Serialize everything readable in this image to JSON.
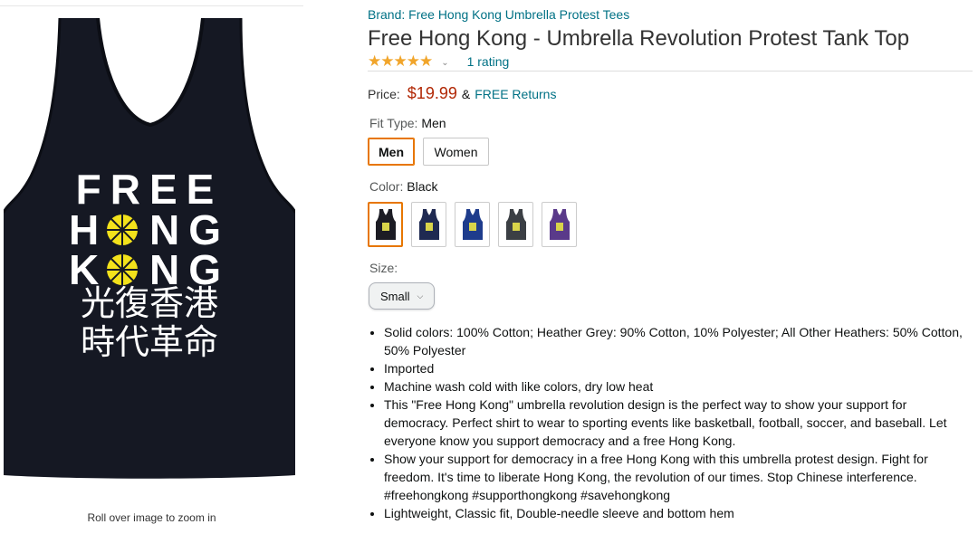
{
  "image": {
    "print_line1": "FREE",
    "print_line2": "HONG",
    "print_line3": "KONG",
    "print_chinese1": "光復香港",
    "print_chinese2": "時代革命",
    "zoom_caption": "Roll over image to zoom in"
  },
  "product": {
    "brand": "Brand: Free Hong Kong Umbrella Protest Tees",
    "title": "Free Hong Kong - Umbrella Revolution Protest Tank Top",
    "stars": "★★★★★",
    "rating_text": "1 rating",
    "price_label": "Price:",
    "price": "$19.99",
    "price_amp": "&",
    "returns": "FREE Returns"
  },
  "fit": {
    "label": "Fit Type:",
    "selected": "Men",
    "options": [
      "Men",
      "Women"
    ]
  },
  "color": {
    "label": "Color:",
    "selected": "Black",
    "swatches": [
      {
        "name": "black",
        "hex": "#1c1c24"
      },
      {
        "name": "navy",
        "hex": "#1f2a52"
      },
      {
        "name": "royal",
        "hex": "#1e3c8c"
      },
      {
        "name": "charcoal",
        "hex": "#3b3f44"
      },
      {
        "name": "purple",
        "hex": "#5a3a8a"
      }
    ]
  },
  "size": {
    "label": "Size:",
    "selected": "Small"
  },
  "bullets": [
    "Solid colors: 100% Cotton; Heather Grey: 90% Cotton, 10% Polyester; All Other Heathers: 50% Cotton, 50% Polyester",
    "Imported",
    "Machine wash cold with like colors, dry low heat",
    "This \"Free Hong Kong\" umbrella revolution design is the perfect way to show your support for democracy. Perfect shirt to wear to sporting events like basketball, football, soccer, and baseball. Let everyone know you support democracy and a free Hong Kong.",
    "Show your support for democracy in a free Hong Kong with this umbrella protest design. Fight for freedom. It's time to liberate Hong Kong, the revolution of our times. Stop Chinese interference. #freehongkong #supporthongkong #savehongkong",
    "Lightweight, Classic fit, Double-needle sleeve and bottom hem"
  ],
  "colors": {
    "link": "#007185",
    "price": "#b12704",
    "star": "#f1a52b",
    "selected_border": "#e77600",
    "umbrella": "#f3e21b"
  }
}
